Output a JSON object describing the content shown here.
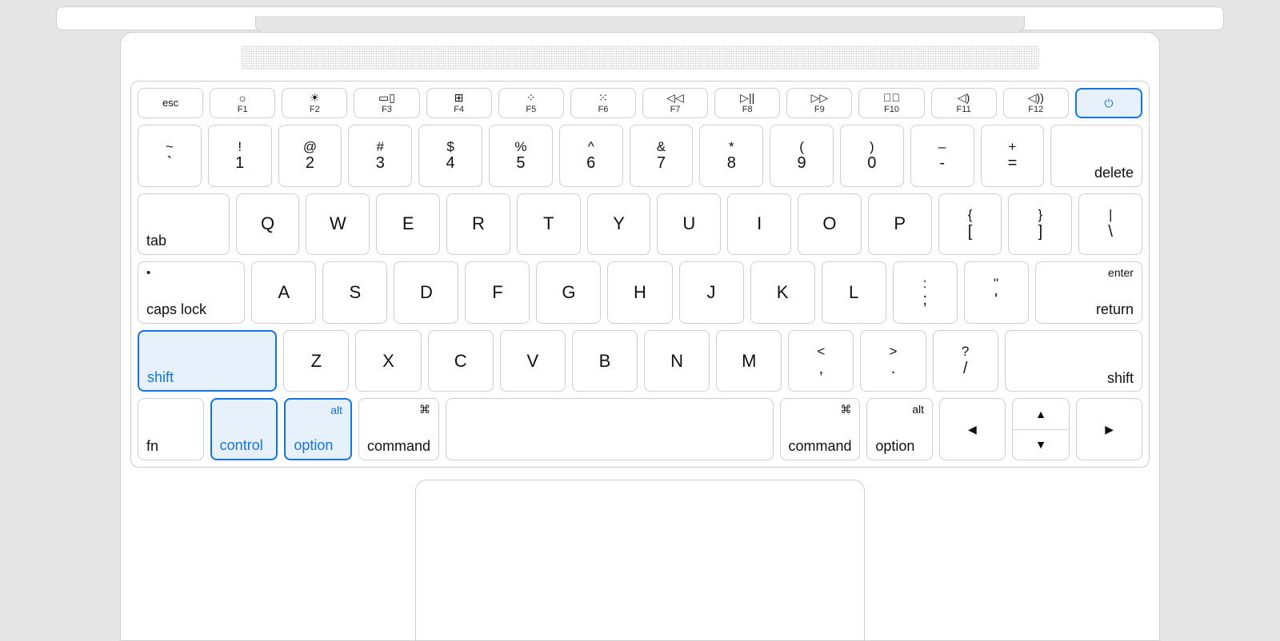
{
  "fnrow": [
    {
      "name": "esc-key",
      "label": "esc"
    },
    {
      "name": "f1-key",
      "icon": "☼",
      "sub": "F1"
    },
    {
      "name": "f2-key",
      "icon": "☀",
      "sub": "F2"
    },
    {
      "name": "f3-key",
      "icon": "▭▯",
      "sub": "F3"
    },
    {
      "name": "f4-key",
      "icon": "⊞",
      "sub": "F4"
    },
    {
      "name": "f5-key",
      "icon": "⁘",
      "sub": "F5"
    },
    {
      "name": "f6-key",
      "icon": "⁙",
      "sub": "F6"
    },
    {
      "name": "f7-key",
      "icon": "◁◁",
      "sub": "F7"
    },
    {
      "name": "f8-key",
      "icon": "▷||",
      "sub": "F8"
    },
    {
      "name": "f9-key",
      "icon": "▷▷",
      "sub": "F9"
    },
    {
      "name": "f10-key",
      "icon": "◁⃠",
      "sub": "F10"
    },
    {
      "name": "f11-key",
      "icon": "◁)",
      "sub": "F11"
    },
    {
      "name": "f12-key",
      "icon": "◁))",
      "sub": "F12"
    },
    {
      "name": "power-key",
      "icon": "⏻",
      "hi": true
    }
  ],
  "row1": [
    {
      "name": "backtick-key",
      "top": "~",
      "bot": "`",
      "cls": "u1"
    },
    {
      "name": "1-key",
      "top": "!",
      "bot": "1",
      "cls": "u1"
    },
    {
      "name": "2-key",
      "top": "@",
      "bot": "2",
      "cls": "u1"
    },
    {
      "name": "3-key",
      "top": "#",
      "bot": "3",
      "cls": "u1"
    },
    {
      "name": "4-key",
      "top": "$",
      "bot": "4",
      "cls": "u1"
    },
    {
      "name": "5-key",
      "top": "%",
      "bot": "5",
      "cls": "u1"
    },
    {
      "name": "6-key",
      "top": "^",
      "bot": "6",
      "cls": "u1"
    },
    {
      "name": "7-key",
      "top": "&",
      "bot": "7",
      "cls": "u1"
    },
    {
      "name": "8-key",
      "top": "*",
      "bot": "8",
      "cls": "u1"
    },
    {
      "name": "9-key",
      "top": "(",
      "bot": "9",
      "cls": "u1"
    },
    {
      "name": "0-key",
      "top": ")",
      "bot": "0",
      "cls": "u1"
    },
    {
      "name": "minus-key",
      "top": "–",
      "bot": "-",
      "cls": "u1"
    },
    {
      "name": "equals-key",
      "top": "+",
      "bot": "=",
      "cls": "u1"
    },
    {
      "name": "delete-key",
      "br": "delete",
      "cls": "u15"
    }
  ],
  "row2": [
    {
      "name": "tab-key",
      "bl": "tab",
      "cls": "u15"
    },
    {
      "name": "q-key",
      "center": "Q",
      "cls": "u1"
    },
    {
      "name": "w-key",
      "center": "W",
      "cls": "u1"
    },
    {
      "name": "e-key",
      "center": "E",
      "cls": "u1"
    },
    {
      "name": "r-key",
      "center": "R",
      "cls": "u1"
    },
    {
      "name": "t-key",
      "center": "T",
      "cls": "u1"
    },
    {
      "name": "y-key",
      "center": "Y",
      "cls": "u1"
    },
    {
      "name": "u-key",
      "center": "U",
      "cls": "u1"
    },
    {
      "name": "i-key",
      "center": "I",
      "cls": "u1"
    },
    {
      "name": "o-key",
      "center": "O",
      "cls": "u1"
    },
    {
      "name": "p-key",
      "center": "P",
      "cls": "u1"
    },
    {
      "name": "lbracket-key",
      "top": "{",
      "bot": "[",
      "cls": "u1"
    },
    {
      "name": "rbracket-key",
      "top": "}",
      "bot": "]",
      "cls": "u1"
    },
    {
      "name": "backslash-key",
      "top": "|",
      "bot": "\\",
      "cls": "u1"
    }
  ],
  "row3": [
    {
      "name": "capslock-key",
      "tl": "•",
      "bl": "caps lock",
      "cls": "u175"
    },
    {
      "name": "a-key",
      "center": "A",
      "cls": "u1"
    },
    {
      "name": "s-key",
      "center": "S",
      "cls": "u1"
    },
    {
      "name": "d-key",
      "center": "D",
      "cls": "u1"
    },
    {
      "name": "f-key",
      "center": "F",
      "cls": "u1"
    },
    {
      "name": "g-key",
      "center": "G",
      "cls": "u1"
    },
    {
      "name": "h-key",
      "center": "H",
      "cls": "u1"
    },
    {
      "name": "j-key",
      "center": "J",
      "cls": "u1"
    },
    {
      "name": "k-key",
      "center": "K",
      "cls": "u1"
    },
    {
      "name": "l-key",
      "center": "L",
      "cls": "u1"
    },
    {
      "name": "semicolon-key",
      "top": ":",
      "bot": ";",
      "cls": "u1"
    },
    {
      "name": "quote-key",
      "top": "''",
      "bot": "'",
      "cls": "u1"
    },
    {
      "name": "return-key",
      "tr": "enter",
      "br": "return",
      "cls": "u175"
    }
  ],
  "row4": [
    {
      "name": "shift-left-key",
      "bl": "shift",
      "cls": "u225",
      "hi": true
    },
    {
      "name": "z-key",
      "center": "Z",
      "cls": "u1"
    },
    {
      "name": "x-key",
      "center": "X",
      "cls": "u1"
    },
    {
      "name": "c-key",
      "center": "C",
      "cls": "u1"
    },
    {
      "name": "v-key",
      "center": "V",
      "cls": "u1"
    },
    {
      "name": "b-key",
      "center": "B",
      "cls": "u1"
    },
    {
      "name": "n-key",
      "center": "N",
      "cls": "u1"
    },
    {
      "name": "m-key",
      "center": "M",
      "cls": "u1"
    },
    {
      "name": "comma-key",
      "top": "<",
      "bot": ",",
      "cls": "u1"
    },
    {
      "name": "period-key",
      "top": ">",
      "bot": ".",
      "cls": "u1"
    },
    {
      "name": "slash-key",
      "top": "?",
      "bot": "/",
      "cls": "u1"
    },
    {
      "name": "shift-right-key",
      "br": "shift",
      "cls": "u225"
    }
  ],
  "row5": [
    {
      "name": "fn-key",
      "bl": "fn",
      "cls": "u1"
    },
    {
      "name": "control-key",
      "bl": "control",
      "cls": "u1",
      "hi": true
    },
    {
      "name": "option-left-key",
      "tr": "alt",
      "bl": "option",
      "cls": "u1",
      "hi": true
    },
    {
      "name": "command-left-key",
      "tr": "⌘",
      "bl": "command",
      "cls": "u125"
    },
    {
      "name": "space-key",
      "cls": "uspc"
    },
    {
      "name": "command-right-key",
      "tr": "⌘",
      "bl": "command",
      "cls": "u125"
    },
    {
      "name": "option-right-key",
      "tr": "alt",
      "bl": "option",
      "cls": "u1"
    }
  ],
  "arrows": {
    "left": "◀",
    "up": "▲",
    "down": "▼",
    "right": "▶"
  }
}
